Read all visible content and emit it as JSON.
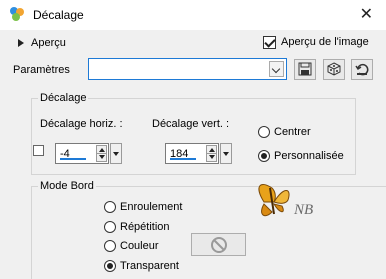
{
  "window": {
    "title": "Décalage"
  },
  "preview": {
    "label": "Aperçu",
    "image_preview_label": "Aperçu de l'image",
    "image_preview_checked": true
  },
  "presets": {
    "label": "Paramètres",
    "value": ""
  },
  "offset_group": {
    "title": "Décalage",
    "horizontal_label": "Décalage horiz. :",
    "horizontal_value": "-4",
    "vertical_label": "Décalage vert. :",
    "vertical_value": "184",
    "options": [
      {
        "label": "Centrer",
        "selected": false
      },
      {
        "label": "Personnalisée",
        "selected": true
      }
    ]
  },
  "edge_group": {
    "title": "Mode Bord",
    "options": [
      {
        "label": "Enroulement",
        "selected": false
      },
      {
        "label": "Répétition",
        "selected": false
      },
      {
        "label": "Couleur",
        "selected": false
      },
      {
        "label": "Transparent",
        "selected": true
      }
    ]
  },
  "watermark": {
    "initials": "NB"
  },
  "colors": {
    "accent": "#1e7ad6",
    "panel": "#f0f0f0",
    "butterfly": "#e8a21a"
  }
}
